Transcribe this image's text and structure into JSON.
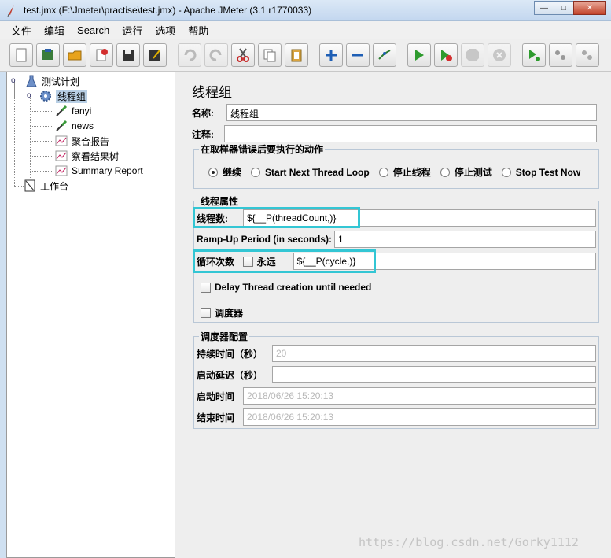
{
  "window": {
    "title": "test.jmx (F:\\Jmeter\\practise\\test.jmx) - Apache JMeter (3.1 r1770033)",
    "minimize": "—",
    "maximize": "□",
    "close": "✕"
  },
  "menu": [
    "文件",
    "编辑",
    "Search",
    "运行",
    "选项",
    "帮助"
  ],
  "toolbar": {
    "icons": [
      "new-icon",
      "templates-icon",
      "open-icon",
      "close-icon",
      "save-icon",
      "save-as-icon",
      "undo-icon",
      "redo-icon",
      "cut-icon",
      "copy-icon",
      "paste-icon",
      "expand-icon",
      "collapse-icon",
      "toggle-icon",
      "start-icon",
      "start-no-pause-icon",
      "stop-icon",
      "shutdown-icon",
      "remote-start-icon",
      "remote-stop-icon",
      "remote-shutdown-icon"
    ]
  },
  "tree": {
    "root": "测试计划",
    "thread_group": "线程组",
    "children": [
      "fanyi",
      "news",
      "聚合报告",
      "察看结果树",
      "Summary Report"
    ],
    "workbench": "工作台"
  },
  "panel": {
    "title": "线程组",
    "name_label": "名称:",
    "name_value": "线程组",
    "comment_label": "注释:",
    "comment_value": "",
    "error_action": {
      "legend": "在取样器错误后要执行的动作",
      "options": [
        "继续",
        "Start Next Thread Loop",
        "停止线程",
        "停止测试",
        "Stop Test Now"
      ],
      "selected": "继续"
    },
    "thread_props": {
      "legend": "线程属性",
      "threads_label": "线程数:",
      "threads_value": "${__P(threadCount,)}",
      "rampup_label": "Ramp-Up Period (in seconds):",
      "rampup_value": "1",
      "loop_label": "循环次数",
      "forever_label": "永远",
      "loop_value": "${__P(cycle,)}",
      "delay_label": "Delay Thread creation until needed",
      "scheduler_label": "调度器"
    },
    "scheduler": {
      "legend": "调度器配置",
      "duration_label": "持续时间（秒）",
      "duration_value": "20",
      "delay_label": "启动延迟（秒）",
      "delay_value": "",
      "start_label": "启动时间",
      "start_value": "2018/06/26 15:20:13",
      "end_label": "结束时间",
      "end_value": "2018/06/26 15:20:13"
    }
  },
  "watermark": "https://blog.csdn.net/Gorky1112",
  "colors": {
    "highlight": "#33c6d4",
    "selection": "#b8cfe5"
  }
}
